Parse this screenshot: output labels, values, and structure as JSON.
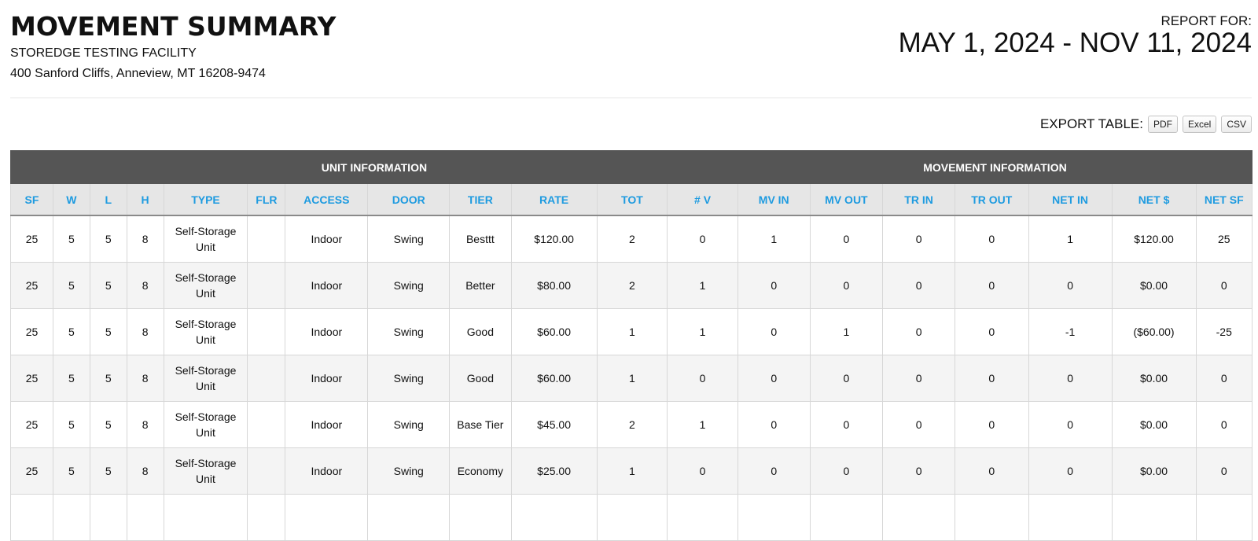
{
  "header": {
    "title": "MOVEMENT SUMMARY",
    "facility": "STOREDGE TESTING FACILITY",
    "address": "400 Sanford Cliffs, Anneview, MT 16208-9474",
    "report_label": "REPORT FOR:",
    "report_range": "MAY 1, 2024 - NOV 11, 2024"
  },
  "export": {
    "label": "EXPORT TABLE:",
    "buttons": [
      "PDF",
      "Excel",
      "CSV"
    ]
  },
  "table": {
    "groups": [
      "UNIT INFORMATION",
      "MOVEMENT INFORMATION"
    ],
    "columns": [
      "SF",
      "W",
      "L",
      "H",
      "TYPE",
      "FLR",
      "ACCESS",
      "DOOR",
      "TIER",
      "RATE",
      "TOT",
      "# V",
      "MV IN",
      "MV OUT",
      "TR IN",
      "TR OUT",
      "NET IN",
      "NET $",
      "NET SF"
    ],
    "rows": [
      [
        "25",
        "5",
        "5",
        "8",
        "Self-Storage Unit",
        "",
        "Indoor",
        "Swing",
        "Besttt",
        "$120.00",
        "2",
        "0",
        "1",
        "0",
        "0",
        "0",
        "1",
        "$120.00",
        "25"
      ],
      [
        "25",
        "5",
        "5",
        "8",
        "Self-Storage Unit",
        "",
        "Indoor",
        "Swing",
        "Better",
        "$80.00",
        "2",
        "1",
        "0",
        "0",
        "0",
        "0",
        "0",
        "$0.00",
        "0"
      ],
      [
        "25",
        "5",
        "5",
        "8",
        "Self-Storage Unit",
        "",
        "Indoor",
        "Swing",
        "Good",
        "$60.00",
        "1",
        "1",
        "0",
        "1",
        "0",
        "0",
        "-1",
        "($60.00)",
        "-25"
      ],
      [
        "25",
        "5",
        "5",
        "8",
        "Self-Storage Unit",
        "",
        "Indoor",
        "Swing",
        "Good",
        "$60.00",
        "1",
        "0",
        "0",
        "0",
        "0",
        "0",
        "0",
        "$0.00",
        "0"
      ],
      [
        "25",
        "5",
        "5",
        "8",
        "Self-Storage Unit",
        "",
        "Indoor",
        "Swing",
        "Base Tier",
        "$45.00",
        "2",
        "1",
        "0",
        "0",
        "0",
        "0",
        "0",
        "$0.00",
        "0"
      ],
      [
        "25",
        "5",
        "5",
        "8",
        "Self-Storage Unit",
        "",
        "Indoor",
        "Swing",
        "Economy",
        "$25.00",
        "1",
        "0",
        "0",
        "0",
        "0",
        "0",
        "0",
        "$0.00",
        "0"
      ],
      [
        "",
        "",
        "",
        "",
        "",
        "",
        "",
        "",
        "",
        "",
        "",
        "",
        "",
        "",
        "",
        "",
        "",
        "",
        ""
      ]
    ]
  }
}
